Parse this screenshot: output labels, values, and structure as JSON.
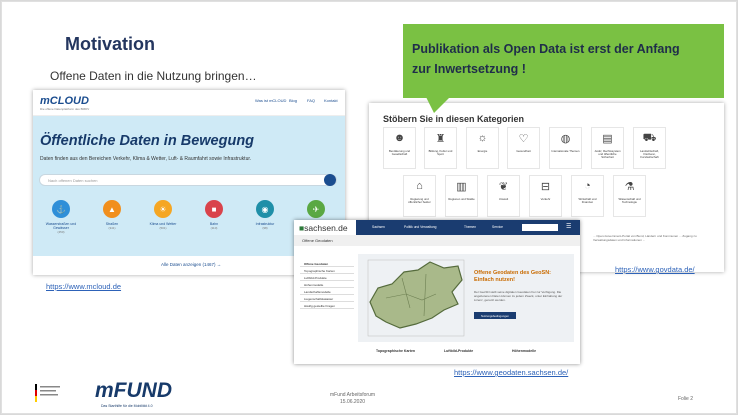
{
  "slide": {
    "title": "Motivation",
    "subtitle": "Offene Daten in die Nutzung bringen…",
    "callout": {
      "line1": "Publikation als Open Data ist erst der Anfang",
      "line2": "zur Inwertsetzung !"
    }
  },
  "mcloud": {
    "logo": "mCLOUD",
    "tagline": "Die offene Datenplattform des BMDV",
    "nav": [
      "Was ist mCLOUD",
      "Blog",
      "FAQ",
      "Kontakt"
    ],
    "headline": "Öffentliche Daten in Bewegung",
    "subline": "Daten finden aus den Bereichen Verkehr, Klima & Wetter, Luft- & Raumfahrt sowie Infrastruktur.",
    "search_placeholder": "Nach offenen Daten suchen",
    "categories": [
      {
        "label": "Wasserstraßen und Gewässer",
        "count": "(450)",
        "color": "#2f8fd8",
        "icon": "ship-icon"
      },
      {
        "label": "Straßen",
        "count": "(341)",
        "color": "#f18f1d",
        "icon": "road-icon"
      },
      {
        "label": "Klima und Wetter",
        "count": "(501)",
        "color": "#f5a623",
        "icon": "weather-icon"
      },
      {
        "label": "Bahn",
        "count": "(110)",
        "color": "#d9434b",
        "icon": "train-icon"
      },
      {
        "label": "Infrastruktur",
        "count": "(98)",
        "color": "#1f8fa8",
        "icon": "infrastructure-icon"
      },
      {
        "label": "Luft­fahrt",
        "count": "(45)",
        "color": "#5aa843",
        "icon": "plane-icon"
      }
    ],
    "all_link": "Alle Daten anzeigen (1467) →",
    "url": "https://www.mcloud.de"
  },
  "govdata": {
    "heading": "Stöbern Sie in diesen Kategorien",
    "categories": [
      {
        "label": "Bevölkerung und Gesellschaft",
        "icon": "people-icon"
      },
      {
        "label": "Bildung, Kultur und Sport",
        "icon": "education-icon"
      },
      {
        "label": "Energie",
        "icon": "energy-icon"
      },
      {
        "label": "Gesundheit",
        "icon": "health-icon"
      },
      {
        "label": "Internationale Themen",
        "icon": "globe-icon"
      },
      {
        "label": "Justiz, Rechtssystem und öffentliche Sicherheit",
        "icon": "justice-icon"
      },
      {
        "label": "Landwirtschaft, Fischerei, Forstwirtschaft",
        "icon": "tractor-icon"
      },
      {
        "label": "Regierung und öffentlicher Sektor",
        "icon": "government-icon"
      },
      {
        "label": "Regionen und Städte",
        "icon": "city-icon"
      },
      {
        "label": "Umwelt",
        "icon": "leaf-icon"
      },
      {
        "label": "Verkehr",
        "icon": "traffic-icon"
      },
      {
        "label": "Wirtschaft und Finanzen",
        "icon": "finance-icon"
      },
      {
        "label": "Wissenschaft und Technologie",
        "icon": "science-icon"
      }
    ],
    "footer_text": "... Open-Government-Portal von Bund, Ländern und Kommunen ... Zugang zu Verwaltungsdaten und Informationen ...",
    "url": "https://www.govdata.de/"
  },
  "sachsen": {
    "logo": "sachsen.de",
    "nav": [
      "Sachsen",
      "Politik und Verwaltung",
      "Themen",
      "Service"
    ],
    "breadcrumb": "Offene Geodaten",
    "sidebar": [
      "Offene Geodaten",
      "Topographische Karten",
      "Luftbild-Produkte",
      "Höhenmodelle",
      "Landschaftsmodelle",
      "Liegenschaftskataster",
      "Häufig gestellte Fragen"
    ],
    "headline": "Offene Geodaten des GeoSN: Einfach nutzen!",
    "paragraph": "Der GeoSN stellt seine digitalen Geodaten frei zur Verfügung. Die angebotenen Daten können zu jedem Zweck, unter Einhaltung der Lizenz, genutzt werden.",
    "button": "Nutzungsbedingungen",
    "footer_items": [
      "Topographische Karten",
      "Luftbild-Produkte",
      "Höhenmodelle"
    ],
    "url": "https://www.geodaten.sachsen.de/"
  },
  "footer": {
    "logo": "mFUND",
    "tagline": "Das Starthilfe für die Mobilität 4.0",
    "event_line1": "mFund Arbeitsforum",
    "event_line2": "15.06.2020",
    "page": "Folie 2"
  }
}
